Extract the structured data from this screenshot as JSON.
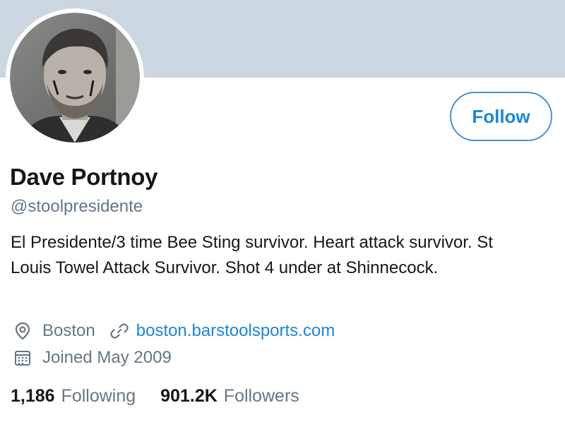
{
  "profile": {
    "display_name": "Dave Portnoy",
    "handle": "@stoolpresidente",
    "bio": "El Presidente/3 time Bee Sting survivor. Heart attack survivor. St Louis Towel Attack Survivor. Shot 4 under at Shinnecock.",
    "location": "Boston",
    "website": "boston.barstoolsports.com",
    "joined": "Joined May 2009",
    "avatar_icon": "profile-photo",
    "banner_color": "#ccd6e0"
  },
  "actions": {
    "follow_label": "Follow"
  },
  "stats": {
    "following_count": "1,186",
    "following_label": "Following",
    "followers_count": "901.2K",
    "followers_label": "Followers"
  },
  "icons": {
    "location": "location-pin-icon",
    "link": "link-icon",
    "calendar": "calendar-icon"
  },
  "colors": {
    "accent": "#1d86d6",
    "text_primary": "#14171a",
    "text_secondary": "#657786"
  }
}
